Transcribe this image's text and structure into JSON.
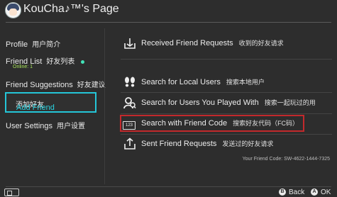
{
  "header": {
    "title": "KouCha♪™'s Page",
    "avatar": "avatar"
  },
  "nav": {
    "items": [
      {
        "label": "Profile",
        "zh": "用户简介"
      },
      {
        "label": "Friend List",
        "zh": "好友列表",
        "sub": "Online: 1"
      },
      {
        "label": "Friend Suggestions",
        "zh": "好友建议"
      },
      {
        "label": "Add Friend",
        "zh": "添加好友"
      },
      {
        "label": "User Settings",
        "zh": "用户设置"
      }
    ],
    "selected_index": 3,
    "selected_color": "#24c6d8"
  },
  "options": [
    {
      "label": "Received Friend Requests",
      "zh": "收到的好友请求",
      "icon": "inbox-icon"
    },
    {
      "label": "Search for Local Users",
      "zh": "搜索本地用户",
      "icon": "footprints-icon"
    },
    {
      "label": "Search for Users You Played With",
      "zh": "搜索一起玩过的用",
      "icon": "search-user-icon"
    },
    {
      "label": "Search with Friend Code",
      "zh": "搜索好友代码（FC码）",
      "icon": "keypad-icon",
      "icon_text": "123"
    },
    {
      "label": "Sent Friend Requests",
      "zh": "发送过的好友请求",
      "icon": "outbox-icon"
    }
  ],
  "friend_code": "Your Friend Code: SW-4622-1444-7325",
  "highlight_color": "#c2292c",
  "footer": {
    "back_label": "Back",
    "back_key": "B",
    "ok_label": "OK",
    "ok_key": "A"
  }
}
